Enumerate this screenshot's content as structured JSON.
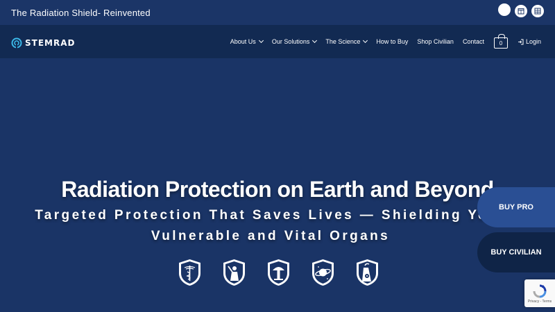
{
  "topbar": {
    "tagline": "The Radiation Shield- Reinvented"
  },
  "logo": {
    "text": "STEMRAD"
  },
  "nav": {
    "items": [
      {
        "label": "About Us",
        "has_dropdown": true
      },
      {
        "label": "Our Solutions",
        "has_dropdown": true
      },
      {
        "label": "The Science",
        "has_dropdown": true
      },
      {
        "label": "How to Buy",
        "has_dropdown": false
      },
      {
        "label": "Shop Civilian",
        "has_dropdown": false
      },
      {
        "label": "Contact",
        "has_dropdown": false
      }
    ],
    "cart_count": "0",
    "login_label": "Login"
  },
  "hero": {
    "title": "Radiation Protection on Earth and Beyond",
    "subtitle_line1": "Targeted Protection That Saves Lives — Shielding Your",
    "subtitle_line2": "Vulnerable and Vital Organs",
    "badges": [
      "medical-shield-icon",
      "military-shield-icon",
      "nuclear-shield-icon",
      "space-shield-icon",
      "industry-shield-icon"
    ]
  },
  "side_buttons": {
    "buy_pro": "BUY PRO",
    "buy_civilian": "BUY CIVILIAN"
  },
  "recaptcha": {
    "text": "Privacy - Terms"
  },
  "colors": {
    "background": "#1a3466",
    "navbar": "#122a52",
    "buy_pro": "#2a4f94",
    "buy_civilian": "#0f2447",
    "logo_accent": "#3bb8e8"
  }
}
